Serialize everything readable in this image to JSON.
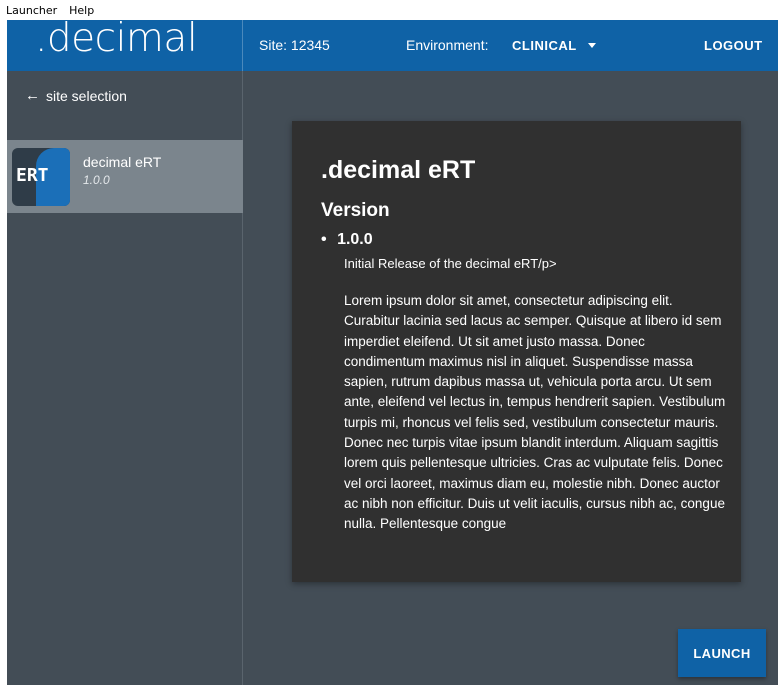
{
  "menubar": {
    "items": [
      "Launcher",
      "Help"
    ]
  },
  "header": {
    "logo": ".decimal",
    "site_label": "Site: 12345",
    "environment_label": "Environment:",
    "environment_value": "CLINICAL",
    "logout_label": "LOGOUT"
  },
  "sidebar": {
    "back_label": "site selection",
    "apps": [
      {
        "icon_text": "ERT",
        "name": "decimal eRT",
        "version": "1.0.0"
      }
    ]
  },
  "details": {
    "title": ".decimal eRT",
    "subtitle": "Version",
    "version_number": "1.0.0",
    "release_note": "Initial Release of the decimal eRT/p>",
    "body": "Lorem ipsum dolor sit amet, consectetur adipiscing elit. Curabitur lacinia sed lacus ac semper. Quisque at libero id sem imperdiet eleifend. Ut sit amet justo massa. Donec condimentum maximus nisl in aliquet. Suspendisse massa sapien, rutrum dapibus massa ut, vehicula porta arcu. Ut sem ante, eleifend vel lectus in, tempus hendrerit sapien. Vestibulum turpis mi, rhoncus vel felis sed, vestibulum consectetur mauris. Donec nec turpis vitae ipsum blandit interdum. Aliquam sagittis lorem quis pellentesque ultricies. Cras ac vulputate felis. Donec vel orci laoreet, maximus diam eu, molestie nibh. Donec auctor ac nibh non efficitur. Duis ut velit iaculis, cursus nibh ac, congue nulla. Pellentesque congue"
  },
  "launch_label": "LAUNCH",
  "colors": {
    "primary": "#0f62a6",
    "background": "#434d56",
    "card": "#303030",
    "selected_item": "#7b858d"
  }
}
